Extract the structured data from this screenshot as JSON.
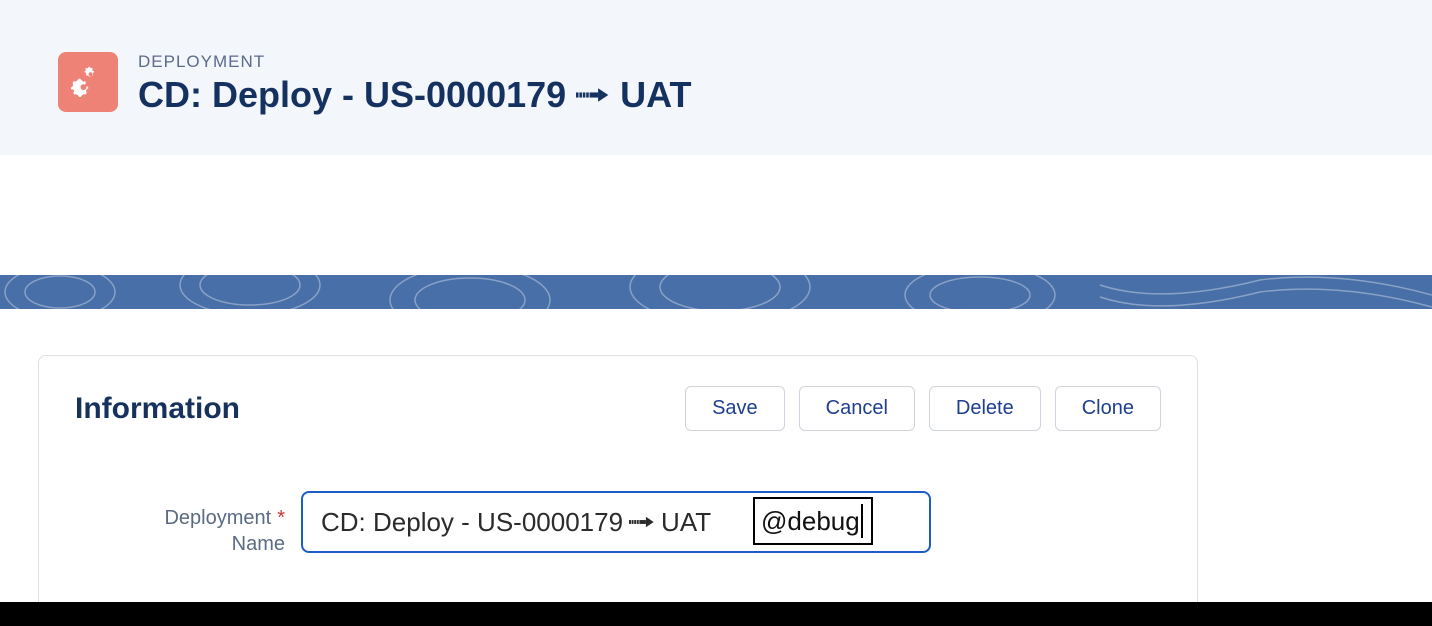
{
  "header": {
    "object_label": "DEPLOYMENT",
    "title_prefix": "CD: Deploy - US-0000179",
    "title_suffix": "UAT"
  },
  "section": {
    "title": "Information"
  },
  "buttons": {
    "save": "Save",
    "cancel": "Cancel",
    "delete": "Delete",
    "clone": "Clone"
  },
  "field": {
    "label_line1": "Deployment",
    "label_line2": "Name",
    "value_prefix": "CD: Deploy - US-0000179",
    "value_suffix": "UAT",
    "ime_text": "@debug"
  }
}
